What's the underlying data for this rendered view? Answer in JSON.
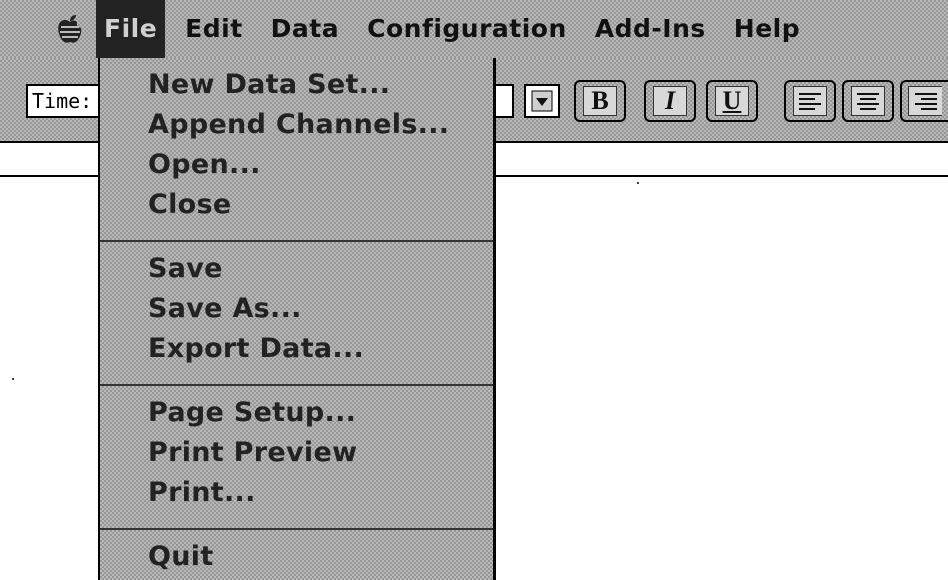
{
  "menubar": {
    "apple_icon": "apple-logo-icon",
    "menus": [
      "File",
      "Edit",
      "Data",
      "Configuration",
      "Add-Ins",
      "Help"
    ],
    "active_menu": "File"
  },
  "toolbar": {
    "font_field_value": "Time:",
    "dropdown_icon": "triangle-down-icon",
    "bold_label": "B",
    "italic_label": "I",
    "underline_label": "U",
    "align_icons": [
      "align-left-icon",
      "align-center-icon",
      "align-right-icon"
    ]
  },
  "file_menu": {
    "groups": [
      [
        "New Data Set...",
        "Append Channels...",
        "Open...",
        "Close"
      ],
      [
        "Save",
        "Save As...",
        "Export Data..."
      ],
      [
        "Page Setup...",
        "Print Preview",
        "Print..."
      ],
      [
        "Quit"
      ]
    ]
  }
}
